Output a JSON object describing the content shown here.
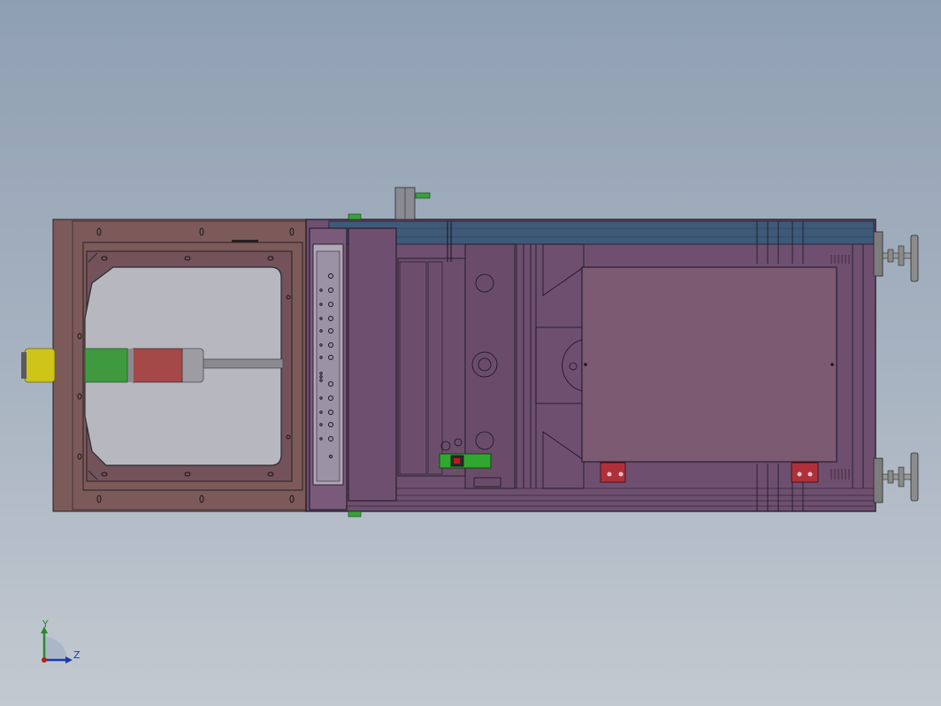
{
  "view": {
    "background_top": "#8f9fb2",
    "background_bottom": "#c3c9d0"
  },
  "model": {
    "parts": [
      "door-frame",
      "window-glass",
      "signal-tower-light",
      "control-panel",
      "main-cabinet",
      "top-rail",
      "internal-plate",
      "green-switch",
      "leveling-feet",
      "red-clamps",
      "top-handle"
    ],
    "colors": {
      "frame": "#7c5a5a",
      "cabinet": "#6e4f6f",
      "plate": "#7b5a72",
      "rail": "#3f5a78",
      "glass": "#b7b7c0",
      "tower_yellow": "#cfc418",
      "tower_green": "#3f9a3f",
      "tower_red": "#a44848",
      "switch_green": "#2ea82e",
      "clamp_red": "#b0303a",
      "foot_gray": "#7c7c7c"
    }
  },
  "triad": {
    "y_label": "Y",
    "z_label": "Z",
    "y_color": "#2a8a2a",
    "z_color": "#1a3aa8",
    "origin_color": "#b22222"
  }
}
